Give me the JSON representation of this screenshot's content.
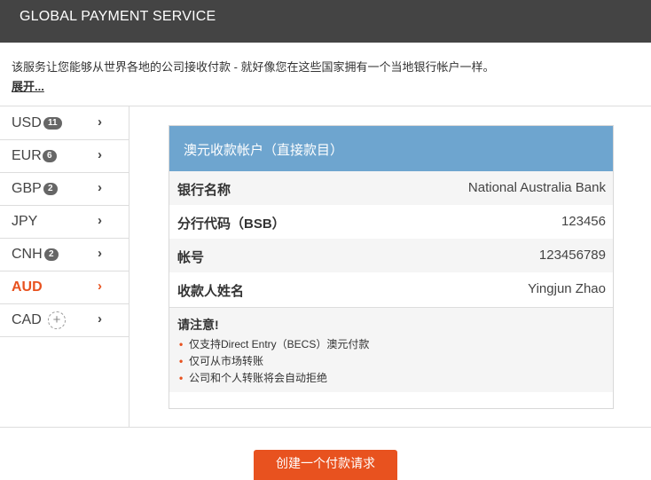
{
  "header": {
    "title": "GLOBAL PAYMENT SERVICE"
  },
  "intro": {
    "text": "该服务让您能够从世界各地的公司接收付款 - 就好像您在这些国家拥有一个当地银行帐户一样。",
    "more_label": "展开..."
  },
  "sidebar": {
    "items": [
      {
        "code": "USD",
        "badge": "11",
        "active": false
      },
      {
        "code": "EUR",
        "badge": "6",
        "active": false
      },
      {
        "code": "GBP",
        "badge": "2",
        "active": false
      },
      {
        "code": "JPY",
        "badge": "",
        "active": false
      },
      {
        "code": "CNH",
        "badge": "2",
        "active": false
      },
      {
        "code": "AUD",
        "badge": "",
        "active": true
      },
      {
        "code": "CAD",
        "badge": "",
        "active": false,
        "add": "+"
      }
    ],
    "chevron": "›"
  },
  "account": {
    "header": "澳元收款帐户（直接款目）",
    "rows": [
      {
        "label": "银行名称",
        "value": "National Australia Bank"
      },
      {
        "label": "分行代码（BSB）",
        "value": "123456"
      },
      {
        "label": "帐号",
        "value": "123456789"
      },
      {
        "label": "收款人姓名",
        "value": "Yingjun Zhao"
      }
    ],
    "note": {
      "title": "请注意!",
      "bullet": "•",
      "items": [
        "仅支持Direct Entry（BECS）澳元付款",
        "仅可从市场转账",
        "公司和个人转账将会自动拒绝"
      ]
    }
  },
  "actions": {
    "create_label": "创建一个付款请求"
  },
  "colors": {
    "accent": "#e8521f",
    "topbar": "#444444",
    "card_header": "#6ea5cf"
  }
}
